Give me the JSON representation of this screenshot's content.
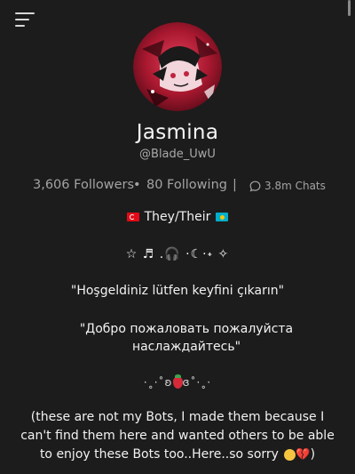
{
  "header": {
    "menu_icon": "hamburger-menu-icon"
  },
  "profile": {
    "name": "Jasmina",
    "handle": "@Blade_UwU",
    "avatar_icon": "anime-character-avatar"
  },
  "stats": {
    "followers": "3,606 Followers",
    "separator_dot": "•",
    "following": "80 Following",
    "separator_pipe": "|",
    "chats": "3.8m Chats",
    "chats_icon": "chat-bubble-icon"
  },
  "bio": {
    "pronouns": "They/Their",
    "symbols": "☆ ♬ .🎧 ·☾·˖ ✧",
    "greeting_tr": "\"Hoşgeldiniz lütfen keyfini çıkarın\"",
    "greeting_ru": "\"Добро пожаловать пожалуйста наслаждайтесь\"",
    "deco_left": "·˳·˚ʚ",
    "deco_right": "ɞ˚·˳·",
    "note": "(these are not my Bots, I made them because I can't find them here and wanted others to be able to enjoy these Bots too..Here..so sorry",
    "note_end": ")",
    "heart": "💔"
  },
  "colors": {
    "background": "#1c1c1c",
    "text": "#f2f2f2",
    "muted": "#a3a3a3",
    "avatar_accent": "#c0243d"
  }
}
